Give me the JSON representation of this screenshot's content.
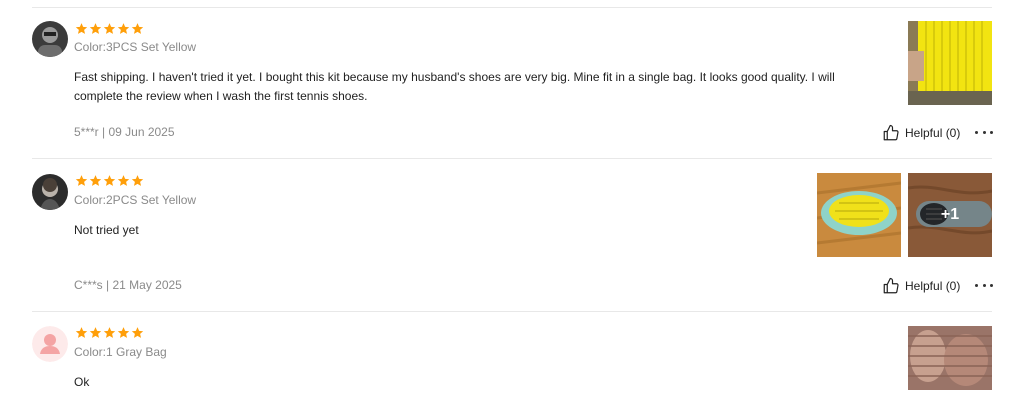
{
  "reviews": [
    {
      "rating": 5,
      "variant": "Color:3PCS Set Yellow",
      "text": "Fast shipping. I haven't tried it yet. I bought this kit because my husband's shoes are very big. Mine fit in a single bag. It looks good quality. I will complete the review when I wash the first tennis shoes.",
      "meta": "5***r | 09 Jun 2025",
      "helpful": "Helpful (0)"
    },
    {
      "rating": 5,
      "variant": "Color:2PCS Set Yellow",
      "text": "Not tried yet",
      "meta": "C***s | 21 May 2025",
      "helpful": "Helpful (0)",
      "more_photos": "+1"
    },
    {
      "rating": 5,
      "variant": "Color:1 Gray Bag",
      "text": "Ok"
    }
  ],
  "colors": {
    "star": "#ff9f0a",
    "muted_text": "#8a8a8a",
    "divider": "#e8e8e8"
  },
  "icons": {
    "rating": "star-icon",
    "helpful": "thumbs-up-icon",
    "more": "more-options-icon"
  }
}
